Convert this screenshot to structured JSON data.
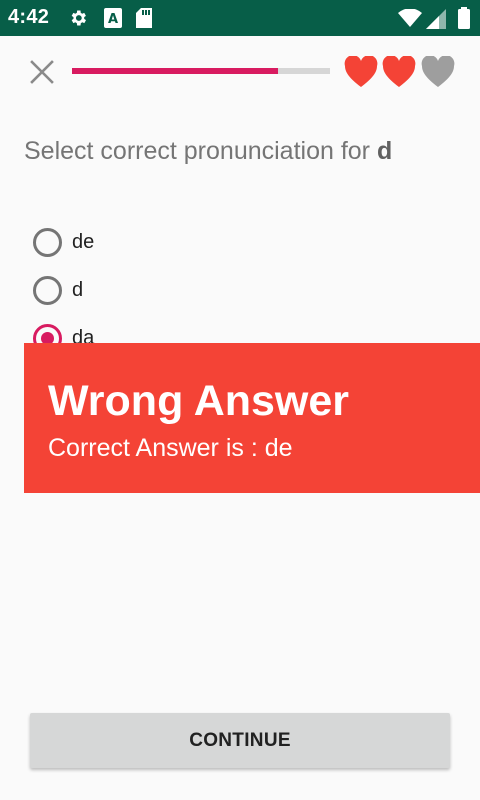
{
  "status_bar": {
    "time": "4:42",
    "icons": [
      "settings-icon",
      "a-icon",
      "sd-card-icon",
      "wifi-icon",
      "signal-icon",
      "battery-icon"
    ]
  },
  "lesson": {
    "progress_fraction": 0.8,
    "lives_total": 3,
    "lives_remaining": 2,
    "colors": {
      "accent": "#d81b60",
      "heart_full": "#f44336",
      "heart_empty": "#9e9e9e"
    }
  },
  "question": {
    "prompt": "Select correct pronunciation for ",
    "target": "d"
  },
  "options": [
    {
      "label": "de",
      "selected": false
    },
    {
      "label": "d",
      "selected": false
    },
    {
      "label": "da",
      "selected": true
    }
  ],
  "feedback": {
    "title": "Wrong Answer",
    "subtitle": "Correct Answer is : de",
    "color": "#f44336"
  },
  "actions": {
    "continue_label": "CONTINUE"
  }
}
